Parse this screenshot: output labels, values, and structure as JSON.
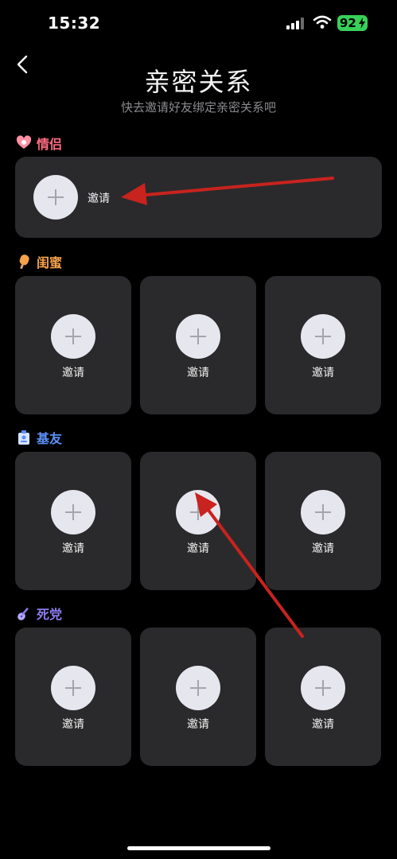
{
  "status_bar": {
    "time": "15:32",
    "battery": "92"
  },
  "header": {
    "title": "亲密关系",
    "subtitle": "快去邀请好友绑定亲密关系吧"
  },
  "sections": [
    {
      "label": "情侣",
      "color": "#ff6b81",
      "slots": [
        {
          "label": "邀请"
        }
      ]
    },
    {
      "label": "闺蜜",
      "color": "#f5a24b",
      "slots": [
        {
          "label": "邀请"
        },
        {
          "label": "邀请"
        },
        {
          "label": "邀请"
        }
      ]
    },
    {
      "label": "基友",
      "color": "#5b8ff9",
      "slots": [
        {
          "label": "邀请"
        },
        {
          "label": "邀请"
        },
        {
          "label": "邀请"
        }
      ]
    },
    {
      "label": "死党",
      "color": "#8c7cf0",
      "slots": [
        {
          "label": "邀请"
        },
        {
          "label": "邀请"
        },
        {
          "label": "邀请"
        }
      ]
    }
  ],
  "icons": {
    "back": "chevron-left-icon",
    "plus": "plus-icon",
    "couple": "heart-icon",
    "bestie": "popsicle-icon",
    "buddy": "badge-icon",
    "pal": "guitar-icon"
  },
  "colors": {
    "background": "#000000",
    "card": "#2a2a2c",
    "plus_circle": "#e6e6ee",
    "annotation_arrow": "#c8231e",
    "battery": "#37d159"
  }
}
